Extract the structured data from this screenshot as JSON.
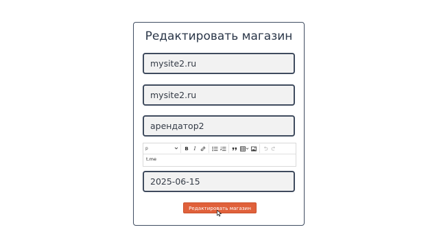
{
  "form": {
    "title": "Редактировать магазин",
    "domain_value": "mysite2.ru",
    "name_value": "mysite2.ru",
    "tenant_value": "арендатор2",
    "date_value": "2025-06-15",
    "submit_label": "Редактировать магазин"
  },
  "editor": {
    "block_format": "p",
    "content": "t.me",
    "toolbar_icons": [
      "chevron-down-icon",
      "bold-icon",
      "italic-icon",
      "link-icon",
      "bullet-list-icon",
      "numbered-list-icon",
      "blockquote-icon",
      "table-icon",
      "image-icon",
      "undo-icon",
      "redo-icon"
    ]
  },
  "colors": {
    "accent": "#e0613b",
    "border": "#3e4a5d",
    "field_bg": "#f2f2f2"
  }
}
